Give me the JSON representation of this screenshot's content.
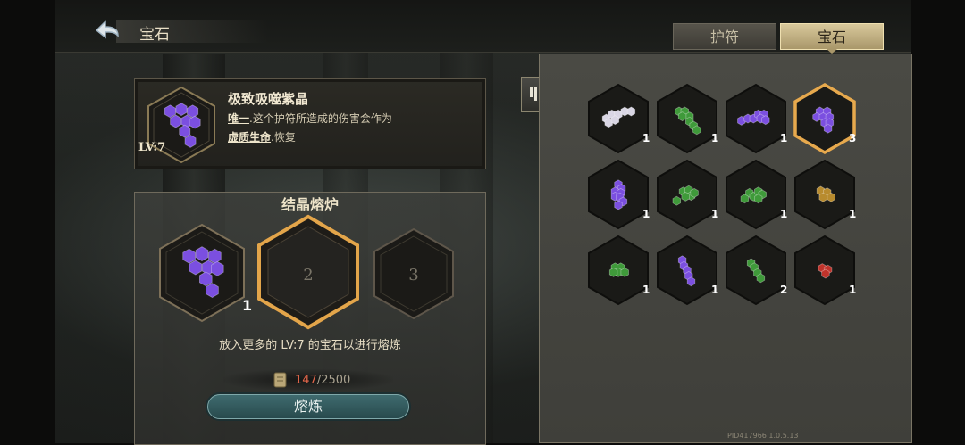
{
  "header": {
    "title": "宝石",
    "tabs": [
      {
        "label": "护符",
        "active": false
      },
      {
        "label": "宝石",
        "active": true
      }
    ]
  },
  "selected_gem": {
    "name": "极致吸噬紫晶",
    "desc_line1_keyword": "唯一",
    "desc_line1_rest": "这个护符所造成的伤害会作为",
    "desc_line2_keyword": "虚质生命",
    "desc_line2_rest": "恢复",
    "level": "LV:7",
    "color": "#7b4fe0"
  },
  "furnace": {
    "title": "结晶熔炉",
    "slots": [
      {
        "label": "",
        "count": "1",
        "filled": true
      },
      {
        "label": "2",
        "filled": false
      },
      {
        "label": "3",
        "filled": false
      }
    ],
    "hint": "放入更多的 LV:7 的宝石以进行熔炼",
    "cost_have": "147",
    "cost_total": "/2500",
    "smelt_label": "熔炼"
  },
  "inventory": [
    {
      "color": "#d9d6e4",
      "count": "1",
      "icon": "white-crystal-gem"
    },
    {
      "color": "#3f9a3a",
      "count": "1",
      "icon": "green-crystal-gem"
    },
    {
      "color": "#7b4fe0",
      "count": "1",
      "icon": "purple-crystal-gem"
    },
    {
      "color": "#7b4fe0",
      "count": "3",
      "icon": "purple-crystal-gem",
      "selected": true
    },
    {
      "color": "#7b4fe0",
      "count": "1",
      "icon": "purple-crystal-gem"
    },
    {
      "color": "#3f9a3a",
      "count": "1",
      "icon": "green-crystal-gem"
    },
    {
      "color": "#3f9a3a",
      "count": "1",
      "icon": "green-crystal-gem"
    },
    {
      "color": "#b88b2e",
      "count": "1",
      "icon": "amber-crystal-gem"
    },
    {
      "color": "#3f9a3a",
      "count": "1",
      "icon": "green-crystal-gem"
    },
    {
      "color": "#7b4fe0",
      "count": "1",
      "icon": "purple-crystal-gem"
    },
    {
      "color": "#3f9a3a",
      "count": "2",
      "icon": "green-crystal-gem"
    },
    {
      "color": "#c0332b",
      "count": "1",
      "icon": "red-crystal-gem"
    }
  ],
  "footer": {
    "version": "PID417966  1.0.5.13"
  }
}
